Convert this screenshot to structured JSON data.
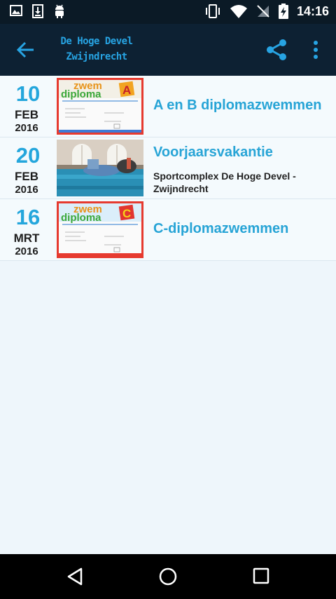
{
  "status_bar": {
    "time": "14:16",
    "icons": [
      "image-icon",
      "download-icon",
      "android-icon",
      "vibrate-icon",
      "wifi-icon",
      "no-signal-icon",
      "battery-charging-icon"
    ]
  },
  "app_bar": {
    "title_line1": "De Hoge Devel",
    "title_line2": "Zwijndrecht",
    "accent_color": "#27a4e3",
    "background": "#0d2133"
  },
  "events": [
    {
      "day": "10",
      "month": "FEB",
      "year": "2016",
      "title": "A en B diplomazwemmen",
      "subtitle": "",
      "thumb": "zwemdiploma-a-thumbnail"
    },
    {
      "day": "20",
      "month": "FEB",
      "year": "2016",
      "title": "Voorjaarsvakantie",
      "subtitle": "Sportcomplex De Hoge Devel - Zwijndrecht",
      "thumb": "swimming-pool-thumbnail"
    },
    {
      "day": "16",
      "month": "MRT",
      "year": "2016",
      "title": "C-diplomazwemmen",
      "subtitle": "",
      "thumb": "zwemdiploma-c-thumbnail"
    }
  ],
  "diploma_art": {
    "line1": "zwem",
    "line2": "diploma",
    "letter_a": "A",
    "letter_c": "C"
  },
  "nav_bar": {
    "icons": [
      "nav-back-icon",
      "nav-home-icon",
      "nav-recents-icon"
    ]
  }
}
